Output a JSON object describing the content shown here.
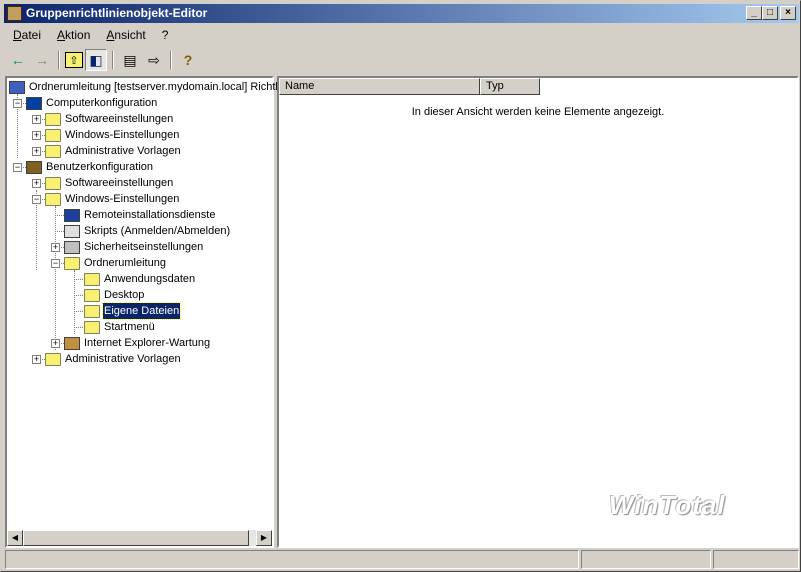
{
  "window": {
    "title": "Gruppenrichtlinienobjekt-Editor",
    "minimize": "_",
    "maximize": "□",
    "close": "×"
  },
  "menu": [
    "Datei",
    "Aktion",
    "Ansicht",
    "?"
  ],
  "toolbar": {
    "back": "←",
    "forward": "→",
    "up": "⇧",
    "show_hide_tree": "◧",
    "properties": "▤",
    "export": "⇨",
    "help": "?"
  },
  "tree": [
    {
      "label": "Ordnerumleitung [testserver.mydomain.local] Richtlinie",
      "level": 0,
      "icon": "policy-icon"
    },
    {
      "label": "Computerkonfiguration",
      "level": 1,
      "exp": "−",
      "icon": "computer-icon"
    },
    {
      "label": "Softwareeinstellungen",
      "level": 2,
      "exp": "+",
      "icon": "folder-icon"
    },
    {
      "label": "Windows-Einstellungen",
      "level": 2,
      "exp": "+",
      "icon": "folder-icon"
    },
    {
      "label": "Administrative Vorlagen",
      "level": 2,
      "exp": "+",
      "icon": "folder-icon"
    },
    {
      "label": "Benutzerkonfiguration",
      "level": 1,
      "exp": "−",
      "icon": "user-icon"
    },
    {
      "label": "Softwareeinstellungen",
      "level": 2,
      "exp": "+",
      "icon": "folder-icon"
    },
    {
      "label": "Windows-Einstellungen",
      "level": 2,
      "exp": "−",
      "icon": "folder-icon"
    },
    {
      "label": "Remoteinstallationsdienste",
      "level": 3,
      "icon": "remote-install-icon"
    },
    {
      "label": "Skripts (Anmelden/Abmelden)",
      "level": 3,
      "icon": "script-icon"
    },
    {
      "label": "Sicherheitseinstellungen",
      "level": 3,
      "exp": "+",
      "icon": "security-icon"
    },
    {
      "label": "Ordnerumleitung",
      "level": 3,
      "exp": "−",
      "icon": "folder-icon"
    },
    {
      "label": "Anwendungsdaten",
      "level": 4,
      "icon": "folder-icon"
    },
    {
      "label": "Desktop",
      "level": 4,
      "icon": "folder-icon"
    },
    {
      "label": "Eigene Dateien",
      "level": 4,
      "icon": "folder-open-icon",
      "selected": true
    },
    {
      "label": "Startmenü",
      "level": 4,
      "icon": "folder-icon"
    },
    {
      "label": "Internet Explorer-Wartung",
      "level": 3,
      "exp": "+",
      "icon": "ie-maintenance-icon"
    },
    {
      "label": "Administrative Vorlagen",
      "level": 2,
      "exp": "+",
      "icon": "folder-icon"
    }
  ],
  "list": {
    "columns": [
      "Name",
      "Typ"
    ],
    "empty_message": "In dieser Ansicht werden keine Elemente angezeigt."
  },
  "watermark": "WinTotal",
  "colors": {
    "titlebar": "#0a246a",
    "selection": "#0a246a",
    "folder": "#f8f070"
  }
}
